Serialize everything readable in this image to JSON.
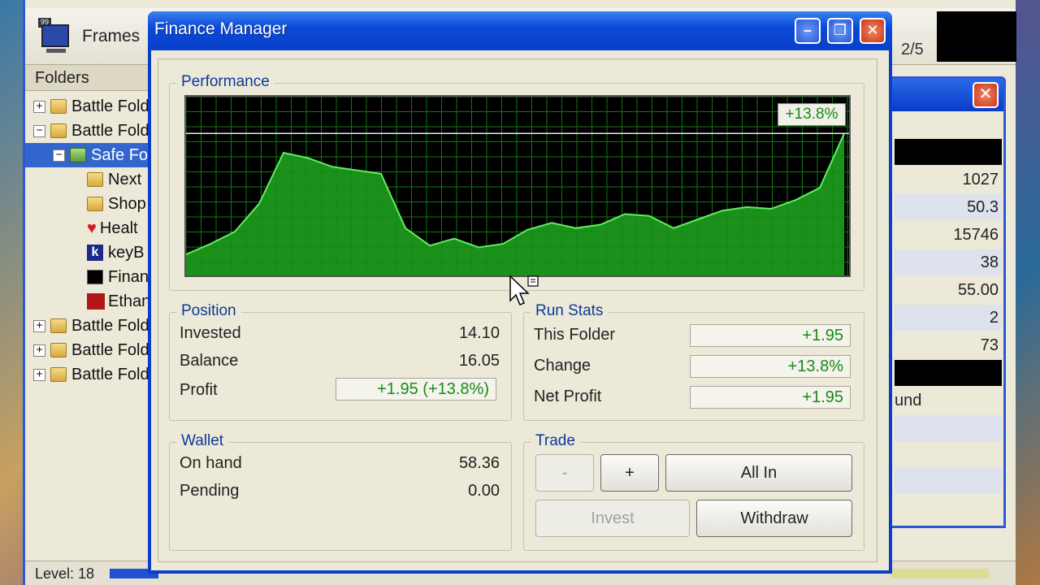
{
  "explorer": {
    "toolbar": {
      "frames_label": "Frames",
      "frames_tag": "99",
      "page_indicator": "2/5"
    },
    "folders_header": "Folders",
    "tree": [
      {
        "label": "Battle Fold",
        "expander": "+"
      },
      {
        "label": "Battle Fold",
        "expander": "−"
      },
      {
        "label": "Safe Fo",
        "expander": "−"
      },
      {
        "label": "Next"
      },
      {
        "label": "Shop"
      },
      {
        "label": "Healt"
      },
      {
        "label": "keyB",
        "icon_letter": "k"
      },
      {
        "label": "Finan"
      },
      {
        "label": "Ethan"
      },
      {
        "label": "Battle Fold",
        "expander": "+"
      },
      {
        "label": "Battle Fold",
        "expander": "+"
      },
      {
        "label": "Battle Fold",
        "expander": "+"
      }
    ],
    "status": {
      "level": "Level: 18"
    }
  },
  "side_panel": {
    "values": [
      "1027",
      "50.3",
      "15746",
      "38",
      "55.00",
      "2",
      "73"
    ],
    "partial_label": "und"
  },
  "finance": {
    "title": "Finance Manager",
    "performance": {
      "title": "Performance",
      "badge": "+13.8%"
    },
    "position": {
      "title": "Position",
      "invested_label": "Invested",
      "invested": "14.10",
      "balance_label": "Balance",
      "balance": "16.05",
      "profit_label": "Profit",
      "profit": "+1.95 (+13.8%)"
    },
    "run_stats": {
      "title": "Run Stats",
      "this_folder_label": "This Folder",
      "this_folder": "+1.95",
      "change_label": "Change",
      "change": "+13.8%",
      "net_profit_label": "Net Profit",
      "net_profit": "+1.95"
    },
    "wallet": {
      "title": "Wallet",
      "on_hand_label": "On hand",
      "on_hand": "58.36",
      "pending_label": "Pending",
      "pending": "0.00"
    },
    "trade": {
      "title": "Trade",
      "minus": "-",
      "plus": "+",
      "all_in": "All In",
      "invest": "Invest",
      "withdraw": "Withdraw"
    }
  },
  "chart_data": {
    "type": "area",
    "values": [
      0.0,
      1.2,
      2.6,
      5.8,
      11.6,
      11.0,
      10.0,
      9.6,
      9.2,
      3.0,
      1.0,
      1.8,
      0.8,
      1.2,
      2.8,
      3.6,
      3.0,
      3.4,
      4.6,
      4.4,
      3.0,
      4.0,
      5.0,
      5.4,
      5.2,
      6.2,
      7.6,
      13.8
    ],
    "ylim": [
      -2.4,
      18
    ],
    "baseline_marker": "+13.8%",
    "grid": true,
    "colors": {
      "fill": "#22b822",
      "line": "#5ef05e",
      "grid": "#1e8c1e",
      "background": "#000000"
    }
  }
}
